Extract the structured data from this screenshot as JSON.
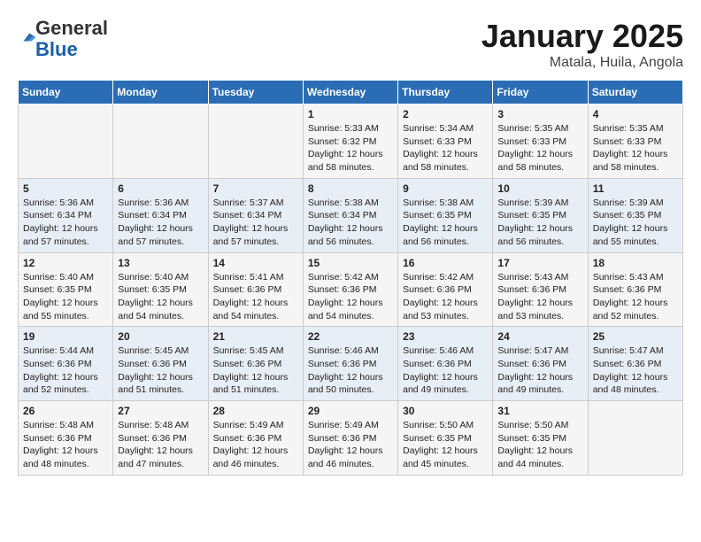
{
  "logo": {
    "general": "General",
    "blue": "Blue"
  },
  "title": "January 2025",
  "location": "Matala, Huila, Angola",
  "days_header": [
    "Sunday",
    "Monday",
    "Tuesday",
    "Wednesday",
    "Thursday",
    "Friday",
    "Saturday"
  ],
  "weeks": [
    [
      {
        "day": "",
        "text": ""
      },
      {
        "day": "",
        "text": ""
      },
      {
        "day": "",
        "text": ""
      },
      {
        "day": "1",
        "text": "Sunrise: 5:33 AM\nSunset: 6:32 PM\nDaylight: 12 hours and 58 minutes."
      },
      {
        "day": "2",
        "text": "Sunrise: 5:34 AM\nSunset: 6:33 PM\nDaylight: 12 hours and 58 minutes."
      },
      {
        "day": "3",
        "text": "Sunrise: 5:35 AM\nSunset: 6:33 PM\nDaylight: 12 hours and 58 minutes."
      },
      {
        "day": "4",
        "text": "Sunrise: 5:35 AM\nSunset: 6:33 PM\nDaylight: 12 hours and 58 minutes."
      }
    ],
    [
      {
        "day": "5",
        "text": "Sunrise: 5:36 AM\nSunset: 6:34 PM\nDaylight: 12 hours and 57 minutes."
      },
      {
        "day": "6",
        "text": "Sunrise: 5:36 AM\nSunset: 6:34 PM\nDaylight: 12 hours and 57 minutes."
      },
      {
        "day": "7",
        "text": "Sunrise: 5:37 AM\nSunset: 6:34 PM\nDaylight: 12 hours and 57 minutes."
      },
      {
        "day": "8",
        "text": "Sunrise: 5:38 AM\nSunset: 6:34 PM\nDaylight: 12 hours and 56 minutes."
      },
      {
        "day": "9",
        "text": "Sunrise: 5:38 AM\nSunset: 6:35 PM\nDaylight: 12 hours and 56 minutes."
      },
      {
        "day": "10",
        "text": "Sunrise: 5:39 AM\nSunset: 6:35 PM\nDaylight: 12 hours and 56 minutes."
      },
      {
        "day": "11",
        "text": "Sunrise: 5:39 AM\nSunset: 6:35 PM\nDaylight: 12 hours and 55 minutes."
      }
    ],
    [
      {
        "day": "12",
        "text": "Sunrise: 5:40 AM\nSunset: 6:35 PM\nDaylight: 12 hours and 55 minutes."
      },
      {
        "day": "13",
        "text": "Sunrise: 5:40 AM\nSunset: 6:35 PM\nDaylight: 12 hours and 54 minutes."
      },
      {
        "day": "14",
        "text": "Sunrise: 5:41 AM\nSunset: 6:36 PM\nDaylight: 12 hours and 54 minutes."
      },
      {
        "day": "15",
        "text": "Sunrise: 5:42 AM\nSunset: 6:36 PM\nDaylight: 12 hours and 54 minutes."
      },
      {
        "day": "16",
        "text": "Sunrise: 5:42 AM\nSunset: 6:36 PM\nDaylight: 12 hours and 53 minutes."
      },
      {
        "day": "17",
        "text": "Sunrise: 5:43 AM\nSunset: 6:36 PM\nDaylight: 12 hours and 53 minutes."
      },
      {
        "day": "18",
        "text": "Sunrise: 5:43 AM\nSunset: 6:36 PM\nDaylight: 12 hours and 52 minutes."
      }
    ],
    [
      {
        "day": "19",
        "text": "Sunrise: 5:44 AM\nSunset: 6:36 PM\nDaylight: 12 hours and 52 minutes."
      },
      {
        "day": "20",
        "text": "Sunrise: 5:45 AM\nSunset: 6:36 PM\nDaylight: 12 hours and 51 minutes."
      },
      {
        "day": "21",
        "text": "Sunrise: 5:45 AM\nSunset: 6:36 PM\nDaylight: 12 hours and 51 minutes."
      },
      {
        "day": "22",
        "text": "Sunrise: 5:46 AM\nSunset: 6:36 PM\nDaylight: 12 hours and 50 minutes."
      },
      {
        "day": "23",
        "text": "Sunrise: 5:46 AM\nSunset: 6:36 PM\nDaylight: 12 hours and 49 minutes."
      },
      {
        "day": "24",
        "text": "Sunrise: 5:47 AM\nSunset: 6:36 PM\nDaylight: 12 hours and 49 minutes."
      },
      {
        "day": "25",
        "text": "Sunrise: 5:47 AM\nSunset: 6:36 PM\nDaylight: 12 hours and 48 minutes."
      }
    ],
    [
      {
        "day": "26",
        "text": "Sunrise: 5:48 AM\nSunset: 6:36 PM\nDaylight: 12 hours and 48 minutes."
      },
      {
        "day": "27",
        "text": "Sunrise: 5:48 AM\nSunset: 6:36 PM\nDaylight: 12 hours and 47 minutes."
      },
      {
        "day": "28",
        "text": "Sunrise: 5:49 AM\nSunset: 6:36 PM\nDaylight: 12 hours and 46 minutes."
      },
      {
        "day": "29",
        "text": "Sunrise: 5:49 AM\nSunset: 6:36 PM\nDaylight: 12 hours and 46 minutes."
      },
      {
        "day": "30",
        "text": "Sunrise: 5:50 AM\nSunset: 6:35 PM\nDaylight: 12 hours and 45 minutes."
      },
      {
        "day": "31",
        "text": "Sunrise: 5:50 AM\nSunset: 6:35 PM\nDaylight: 12 hours and 44 minutes."
      },
      {
        "day": "",
        "text": ""
      }
    ]
  ]
}
